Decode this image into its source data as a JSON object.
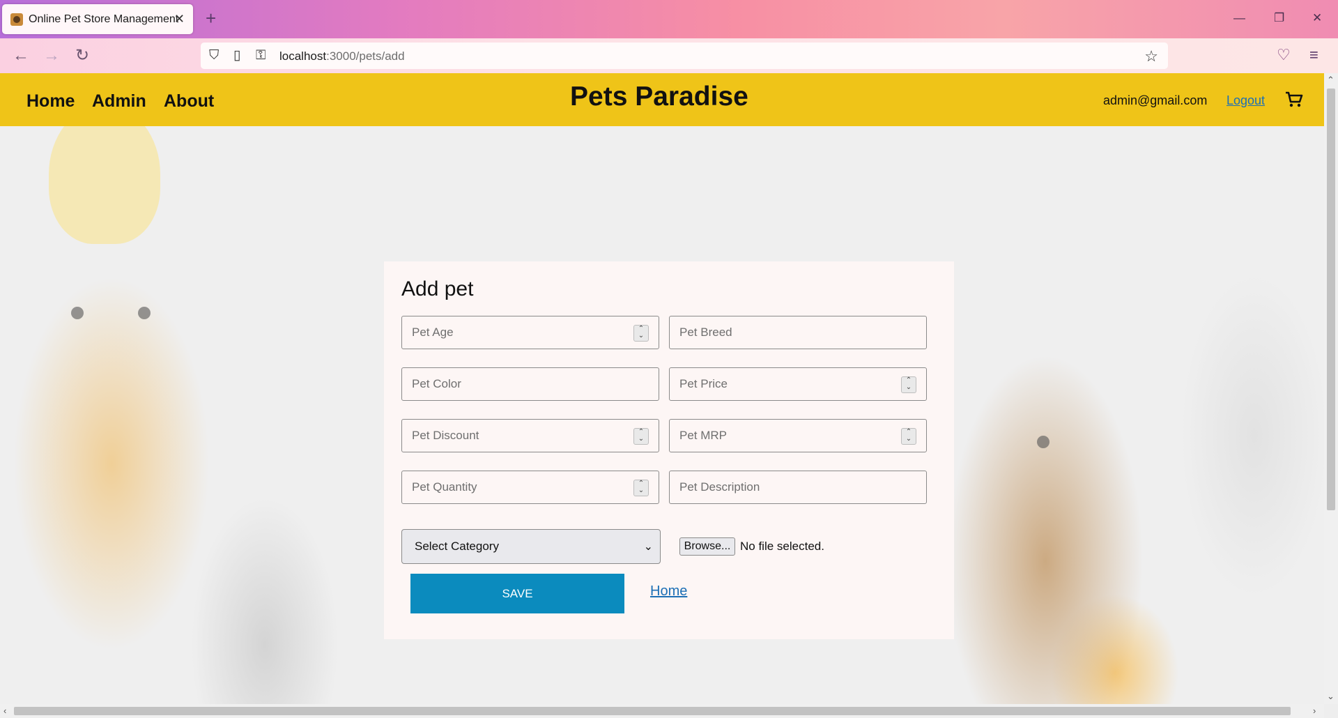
{
  "browser": {
    "tab_title": "Online Pet Store Management",
    "url_host": "localhost",
    "url_path": ":3000/pets/add"
  },
  "header": {
    "nav": [
      "Home",
      "Admin",
      "About"
    ],
    "site_title": "Pets Paradise",
    "user_email": "admin@gmail.com",
    "logout_label": "Logout"
  },
  "form": {
    "title": "Add pet",
    "fields": {
      "age": "Pet Age",
      "breed": "Pet Breed",
      "color": "Pet Color",
      "price": "Pet Price",
      "discount": "Pet Discount",
      "mrp": "Pet MRP",
      "quantity": "Pet Quantity",
      "description": "Pet Description"
    },
    "category_selected": "Select Category",
    "browse_label": "Browse...",
    "file_status": "No file selected.",
    "save_label": "SAVE",
    "home_link": "Home"
  },
  "colors": {
    "header_bg": "#efc418",
    "save_bg": "#0b8bbe",
    "link": "#1c6fb5"
  }
}
